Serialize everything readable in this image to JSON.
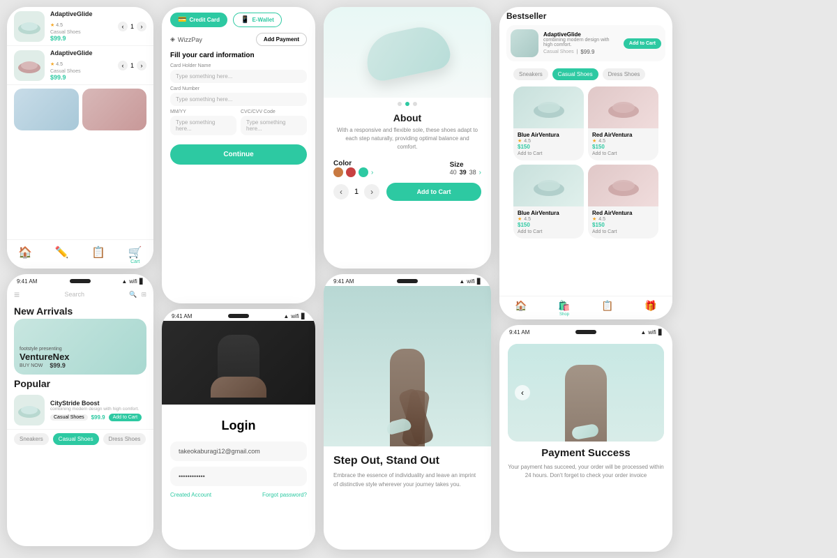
{
  "col1": {
    "phone1": {
      "products": [
        {
          "name": "AdaptiveGlide",
          "cat": "Casual Shoes",
          "rating": "4.5",
          "price": "$99.9",
          "qty": 1
        },
        {
          "name": "AdaptiveGlide",
          "cat": "Casual Shoes",
          "rating": "4.5",
          "price": "$99.9",
          "qty": 1
        }
      ],
      "nav": [
        "🏠",
        "✏️",
        "📋",
        "🛒"
      ]
    },
    "phone2": {
      "search_placeholder": "Search",
      "section1": "New Arrivals",
      "hero_tag": "footstyle presenting",
      "hero_name": "VentureNex",
      "hero_price": "$99.9",
      "hero_cta": "BUY NOW",
      "section2": "Popular",
      "popular_item": {
        "name": "CityStride Boost",
        "desc": "combining modern design with high comfort.",
        "cat": "Casual Shoes",
        "price": "$99.9",
        "btn": "Add to Cart"
      },
      "cat_tabs": [
        "Sneakers",
        "Casual Shoes",
        "Dress Shoes"
      ]
    }
  },
  "col2": {
    "payment": {
      "tab_credit": "Credit Card",
      "tab_ewallet": "E-Wallet",
      "wizzpay": "WizzPay",
      "add_payment": "Add Payment",
      "form_title": "Fill your card information",
      "holder_label": "Card Holder Name",
      "holder_placeholder": "Type something here...",
      "number_label": "Card Number",
      "number_placeholder": "Type something here...",
      "mmyy_label": "MM/YY",
      "mmyy_placeholder": "Type something here...",
      "cvv_label": "CVC/CVV Code",
      "cvv_placeholder": "Type something here...",
      "continue_btn": "Continue"
    },
    "login": {
      "title": "Login",
      "email": "takeokaburagi12@gmail.com",
      "password": "••••••••••••",
      "created": "Created Account",
      "forgot": "Forgot password?"
    }
  },
  "col3": {
    "detail": {
      "about_title": "About",
      "about_desc": "With a responsive and flexible sole, these shoes adapt to each step naturally, providing optimal balance and comfort.",
      "color_label": "Color",
      "colors": [
        "#c87941",
        "#c84141",
        "#2dc9a2"
      ],
      "size_label": "Size",
      "sizes": [
        "40",
        "39",
        "38"
      ],
      "qty": 1,
      "add_to_cart": "Add to Cart",
      "dots": [
        1,
        2,
        3
      ],
      "active_dot": 1
    },
    "step": {
      "title": "Step Out, Stand Out",
      "desc": "Embrace the essence of individuality and leave an imprint of distinctive style wherever your journey takes you."
    }
  },
  "col4": {
    "bestseller": {
      "title": "Bestseller",
      "item": {
        "name": "AdaptiveGlide",
        "desc": "combining modern design with high comfort.",
        "cat": "Casual Shoes",
        "price": "$99.9",
        "btn": "Add to Cart"
      },
      "cat_tabs": [
        "Sneakers",
        "Casual Shoes",
        "Dress Shoes"
      ],
      "active_tab": 1,
      "shoes": [
        {
          "name": "Blue AirVentura",
          "rating": "4.5",
          "price": "$150",
          "btn": "Add to Cart",
          "type": "blue"
        },
        {
          "name": "Red AirVentura",
          "rating": "4.5",
          "price": "$150",
          "btn": "Add to Cart",
          "type": "red"
        },
        {
          "name": "Blue AirVentura",
          "rating": "4.5",
          "price": "$150",
          "btn": "Add to Cart",
          "type": "blue"
        },
        {
          "name": "Red AirVentura",
          "rating": "4.5",
          "price": "$150",
          "btn": "Add to Cart",
          "type": "red"
        }
      ],
      "nav": [
        "🏠",
        "🛍️",
        "📋",
        "🎁"
      ],
      "active_nav": 1,
      "active_nav_label": "Shop"
    },
    "payment_success": {
      "title": "Payment Success",
      "desc": "Your payment has succeed, your order will be processed within 24 hours. Don't forget to check your order invoice"
    }
  }
}
